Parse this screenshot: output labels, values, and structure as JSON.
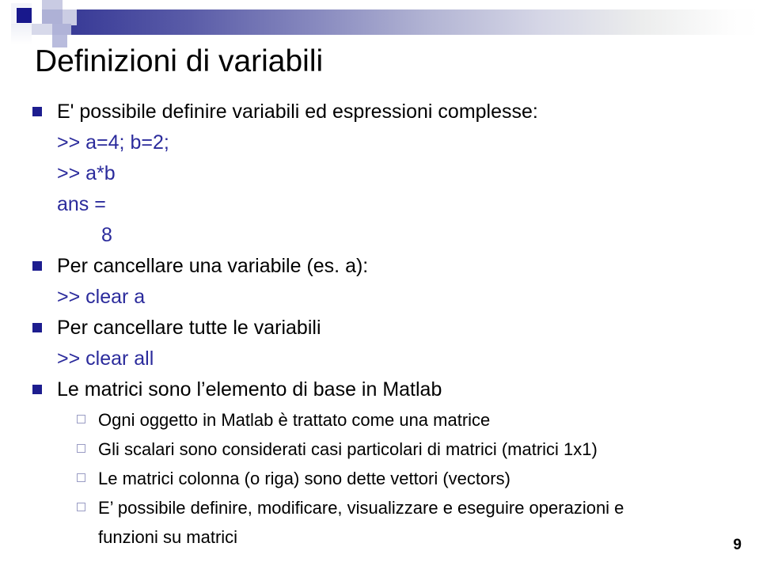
{
  "slide": {
    "title": "Definizioni di variabili",
    "page_number": "9"
  },
  "decor": {
    "bar_start_color": "#2f3191",
    "bar_end_color": "#ffffff",
    "accent_dark": "#1d1d8f",
    "accent_light": "#9a9cc4"
  },
  "content": {
    "bullet1": {
      "text": "E' possibile definire variabili ed espressioni complesse:",
      "code": [
        ">> a=4; b=2;",
        ">> a*b",
        "ans =",
        "8"
      ]
    },
    "bullet2": {
      "text": "Per cancellare una variabile (es. a):",
      "code": [
        ">> clear a"
      ]
    },
    "bullet3": {
      "text": "Per cancellare tutte le variabili",
      "code": [
        ">> clear all"
      ]
    },
    "bullet4": {
      "text": "Le matrici sono l’elemento di base in Matlab",
      "subitems": [
        "Ogni oggetto in Matlab è trattato come una matrice",
        "Gli scalari sono considerati casi particolari di matrici (matrici 1x1)",
        "Le matrici colonna (o riga) sono dette vettori (vectors)",
        "E’ possibile definire, modificare, visualizzare e eseguire operazioni e",
        "funzioni su matrici"
      ]
    }
  }
}
